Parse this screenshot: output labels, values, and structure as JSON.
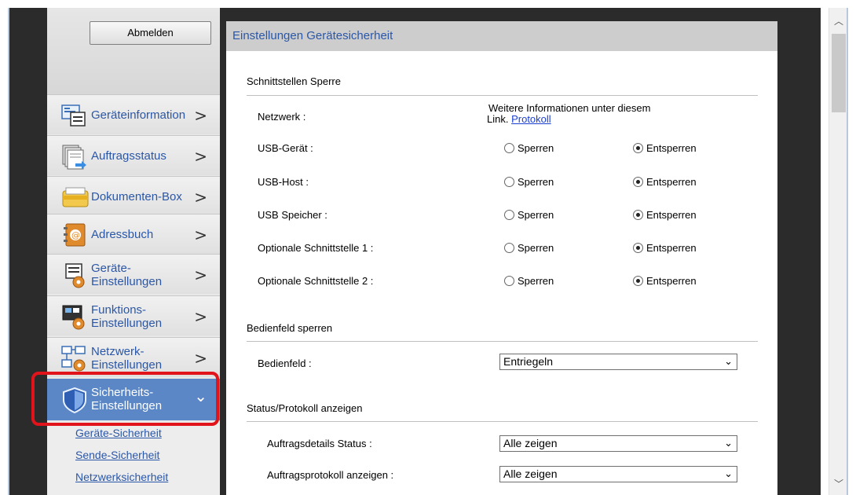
{
  "logout_label": "Abmelden",
  "nav": {
    "items": [
      {
        "line1": "Geräteinformation",
        "line2": ""
      },
      {
        "line1": "Auftragsstatus",
        "line2": ""
      },
      {
        "line1": "Dokumenten-Box",
        "line2": ""
      },
      {
        "line1": "Adressbuch",
        "line2": ""
      },
      {
        "line1": "Geräte-",
        "line2": "Einstellungen"
      },
      {
        "line1": "Funktions-",
        "line2": "Einstellungen"
      },
      {
        "line1": "Netzwerk-",
        "line2": "Einstellungen"
      },
      {
        "line1": "Sicherheits-",
        "line2": "Einstellungen"
      }
    ],
    "chevron_right": ">",
    "chevron_down": "⌄",
    "sub_items": [
      "Geräte-Sicherheit",
      "Sende-Sicherheit",
      "Netzwerksicherheit"
    ]
  },
  "main": {
    "title": "Einstellungen Gerätesicherheit",
    "section_interface": "Schnittstellen Sperre",
    "network_label": "Netzwerk :",
    "network_info": "Weitere Informationen unter diesem",
    "network_info_link_prefix": "Link.",
    "network_info_link": "Protokoll",
    "radio_lock": "Sperren",
    "radio_unlock": "Entsperren",
    "rows": [
      {
        "label": "USB-Gerät :",
        "value": "Entsperren"
      },
      {
        "label": "USB-Host :",
        "value": "Entsperren"
      },
      {
        "label": "USB Speicher :",
        "value": "Entsperren"
      },
      {
        "label": "Optionale Schnittstelle 1 :",
        "value": "Entsperren"
      },
      {
        "label": "Optionale Schnittstelle 2 :",
        "value": "Entsperren"
      }
    ],
    "section_panel": "Bedienfeld sperren",
    "panel_label": "Bedienfeld :",
    "panel_value": "Entriegeln",
    "section_status": "Status/Protokoll anzeigen",
    "job_status_label": "Auftragsdetails Status :",
    "job_status_value": "Alle zeigen",
    "job_log_label": "Auftragsprotokoll anzeigen :",
    "job_log_value": "Alle zeigen",
    "select_arrow": "⌄"
  },
  "scroll": {
    "up": "︿",
    "down": "﹀"
  },
  "colors": {
    "accent": "#5b87c6",
    "highlight": "#e0141a",
    "link": "#2a57a8"
  }
}
